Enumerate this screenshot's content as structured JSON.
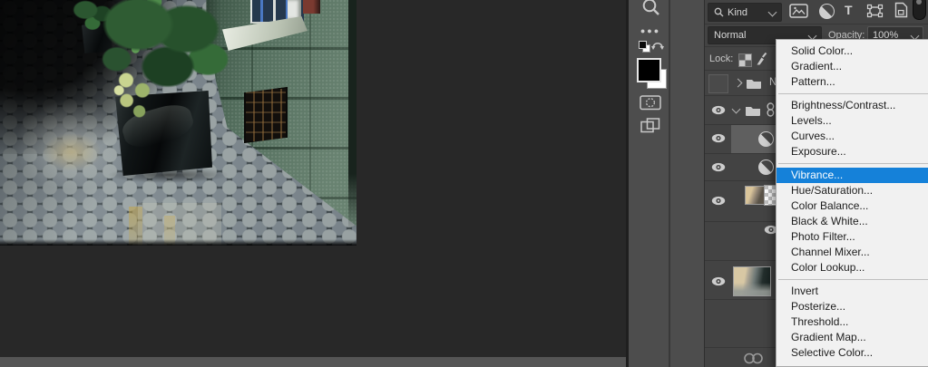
{
  "colors": {
    "pasteboard": "#282828",
    "toolbar_bg": "#4d4d4d",
    "panel_bg": "#434343",
    "field_bg": "#2c2c2c",
    "selected_row": "#5f5f5f",
    "menu_bg": "#f1f1f1",
    "menu_text": "#1d1d1d",
    "menu_highlight": "#1581d9",
    "menu_highlight_text": "#ffffff",
    "icon_color": "#d0d0d0",
    "foreground_swatch": "#000000",
    "background_swatch": "#ffffff"
  },
  "canvas": {
    "subject": "cobblestone courtyard photo with black planter, green shrub and green textured building wall with window, sill and basement grate"
  },
  "toolbar": {
    "tools": [
      {
        "name": "zoom-tool"
      },
      {
        "name": "edit-toolbar-ellipsis"
      },
      {
        "name": "default-colors"
      },
      {
        "name": "swap-colors"
      },
      {
        "name": "foreground-color",
        "value": "#000000"
      },
      {
        "name": "background-color",
        "value": "#ffffff"
      },
      {
        "name": "quick-mask-mode"
      },
      {
        "name": "screen-mode"
      }
    ]
  },
  "layers_panel": {
    "filter_bar": {
      "kind_label": "Kind",
      "filters": [
        "filter-pixel-layers",
        "filter-adjustment-layers",
        "filter-type-layers",
        "filter-shape-layers",
        "filter-smart-objects"
      ],
      "toggle": "layer-filtering-toggle"
    },
    "blend_row": {
      "blend_mode": "Normal",
      "opacity_label": "Opacity:",
      "opacity_value": "100%"
    },
    "lock_row": {
      "label": "Lock:",
      "locks": [
        "lock-transparent-pixels",
        "lock-image-pixels"
      ]
    },
    "rows": [
      {
        "type": "group",
        "state": "collapsed",
        "eye": false,
        "name_fragment": "N"
      },
      {
        "type": "group",
        "state": "expanded",
        "eye": true,
        "link_badge": true
      },
      {
        "type": "adjustment-layer",
        "eye": true,
        "selected": true
      },
      {
        "type": "adjustment-layer",
        "eye": true
      },
      {
        "type": "layer-with-mask",
        "eye": true
      },
      {
        "type": "nested-layer-mostly-hidden-behind-menu",
        "eye": true
      },
      {
        "type": "background-image-layer",
        "eye": true
      }
    ],
    "bottom_bar": {
      "icons": [
        "link-layers"
      ]
    }
  },
  "adjustment_menu": {
    "highlighted_item": "Vibrance...",
    "items": [
      {
        "label": "Solid Color..."
      },
      {
        "label": "Gradient..."
      },
      {
        "label": "Pattern..."
      },
      {
        "label": "Brightness/Contrast..."
      },
      {
        "label": "Levels..."
      },
      {
        "label": "Curves..."
      },
      {
        "label": "Exposure..."
      },
      {
        "label": "Vibrance..."
      },
      {
        "label": "Hue/Saturation..."
      },
      {
        "label": "Color Balance..."
      },
      {
        "label": "Black & White..."
      },
      {
        "label": "Photo Filter..."
      },
      {
        "label": "Channel Mixer..."
      },
      {
        "label": "Color Lookup..."
      },
      {
        "label": "Invert"
      },
      {
        "label": "Posterize..."
      },
      {
        "label": "Threshold..."
      },
      {
        "label": "Gradient Map..."
      },
      {
        "label": "Selective Color..."
      }
    ]
  }
}
